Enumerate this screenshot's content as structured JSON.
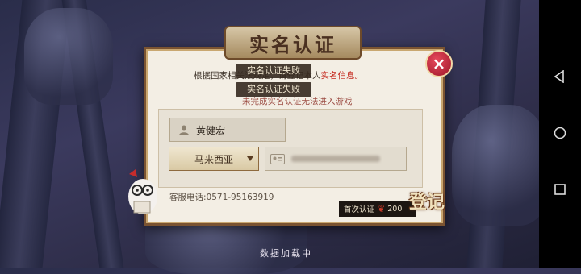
{
  "dialog": {
    "title": "实名认证",
    "close_label": "×",
    "notice_prefix": "根据国家相关法",
    "notice_middle": "规定，请登记本人",
    "notice_highlight": "实名信息。",
    "notice_second": "未完成实名认证无法进入游戏"
  },
  "toasts": [
    "实名认证失败",
    "实名认证失败"
  ],
  "form": {
    "name_value": "黄健宏",
    "country_value": "马来西亚"
  },
  "footer": {
    "customer_service": "客服电话:0571-95163919",
    "first_auth_label": "首次认证",
    "reward_count": "200",
    "login_label": "登记"
  },
  "status": {
    "loading_text": "数据加载中"
  },
  "colors": {
    "dialog_bg": "#f3eee4",
    "frame": "#7a5331",
    "highlight": "#c4261b",
    "close_red": "#c92a3a"
  },
  "icons": {
    "close": "close-icon",
    "user": "user-icon",
    "id_card": "id-card-icon",
    "ruby": "ruby-icon",
    "back": "back-icon",
    "home": "home-icon",
    "recent": "recent-apps-icon"
  }
}
